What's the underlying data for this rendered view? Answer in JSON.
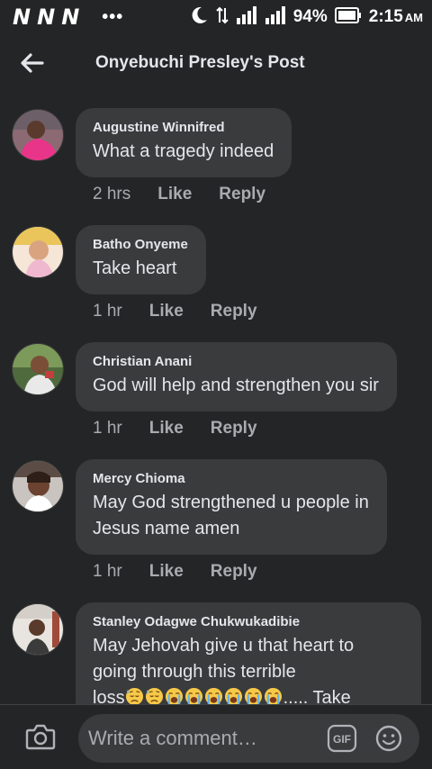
{
  "status_bar": {
    "notifications": [
      "N",
      "N",
      "N"
    ],
    "more": "•••",
    "battery": "94%",
    "time": "2:15",
    "ampm": "AM",
    "icons": [
      "moon-icon",
      "data-arrows-icon",
      "signal-icon",
      "battery-icon"
    ]
  },
  "header": {
    "title": "Onyebuchi Presley's Post",
    "back_icon": "back-arrow-icon"
  },
  "comments": [
    {
      "author": "Augustine Winnifred",
      "lines": [
        "What a tragedy indeed"
      ],
      "time": "2 hrs",
      "like": "Like",
      "reply": "Reply"
    },
    {
      "author": "Batho Onyeme",
      "lines": [
        "Take heart"
      ],
      "time": "1 hr",
      "like": "Like",
      "reply": "Reply"
    },
    {
      "author": "Christian Anani",
      "lines": [
        "God will help and strengthen you sir"
      ],
      "time": "1 hr",
      "like": "Like",
      "reply": "Reply"
    },
    {
      "author": "Mercy Chioma",
      "lines": [
        "May God strengthened u people in",
        "Jesus name amen"
      ],
      "time": "1 hr",
      "like": "Like",
      "reply": "Reply"
    },
    {
      "author": "Stanley Odagwe Chukwukadibie",
      "lines": [
        "May Jehovah give u that heart to",
        "going through this terrible"
      ],
      "last_line_start": "loss",
      "emojis": [
        "sweat-face",
        "sweat-face",
        "crying-face",
        "crying-face",
        "crying-face",
        "crying-face",
        "crying-face",
        "crying-face"
      ],
      "last_line_end": "..... Take"
    }
  ],
  "composer": {
    "placeholder": "Write a comment…",
    "gif_label": "GIF",
    "camera_icon": "camera-icon",
    "emoji_icon": "smiley-icon"
  },
  "colors": {
    "background": "#242526",
    "bubble": "#3a3b3c",
    "text": "#e4e6eb",
    "muted": "#a8abaf"
  }
}
